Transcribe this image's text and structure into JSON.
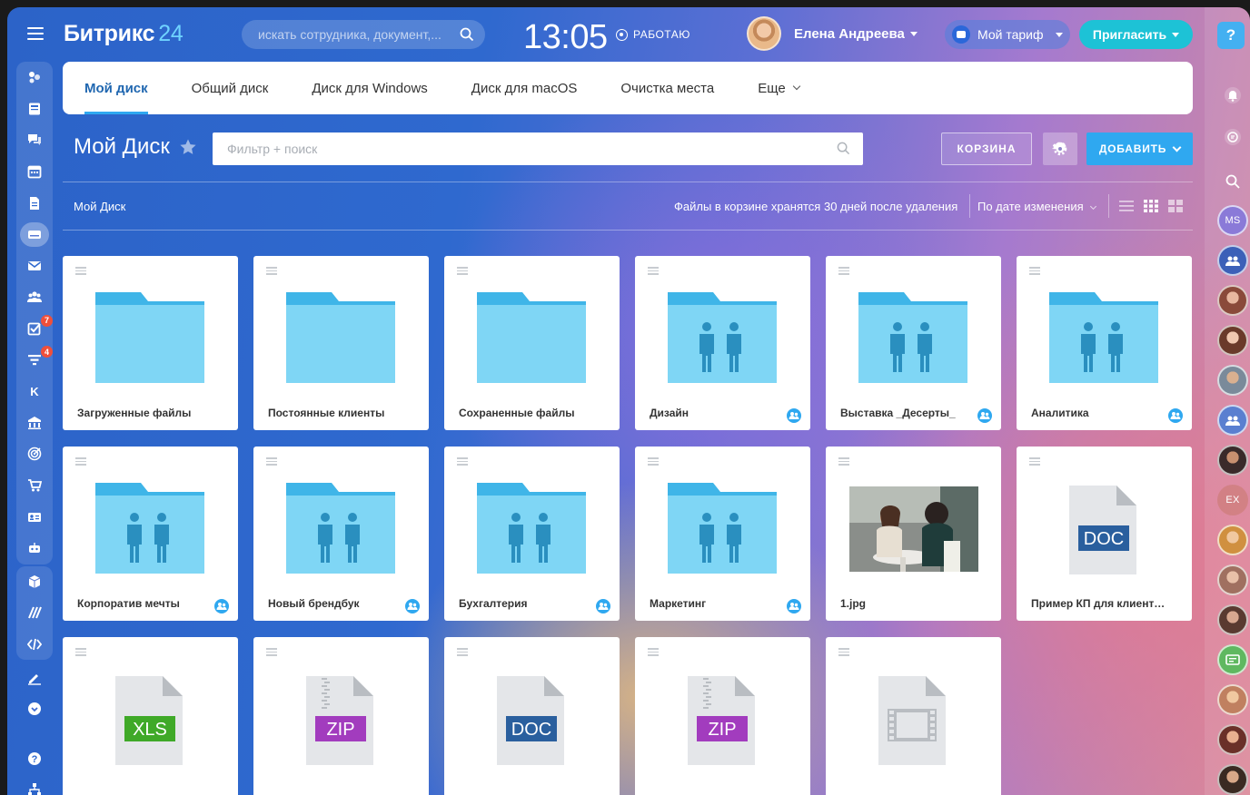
{
  "app": {
    "logo_text": "Битрикс",
    "logo_number": "24",
    "search_placeholder": "искать сотрудника, документ,...",
    "clock": "13:05",
    "status": "РАБОТАЮ",
    "user_name": "Елена Андреева",
    "tariff": "Мой тариф",
    "invite": "Пригласить",
    "help": "?"
  },
  "sidebar": {
    "badges": {
      "tasks": "7",
      "crm": "4"
    },
    "letter_item": "K"
  },
  "rightbar": {
    "initials_1": "MS",
    "initials_2": "EX"
  },
  "tabs": [
    {
      "label": "Мой диск",
      "active": true
    },
    {
      "label": "Общий диск"
    },
    {
      "label": "Диск для Windows"
    },
    {
      "label": "Диск для macOS"
    },
    {
      "label": "Очистка места"
    },
    {
      "label": "Еще"
    }
  ],
  "page": {
    "title": "Мой Диск",
    "filter_placeholder": "Фильтр + поиск",
    "trash_button": "КОРЗИНА",
    "add_button": "ДОБАВИТЬ",
    "breadcrumb": "Мой Диск",
    "trash_note": "Файлы в корзине хранятся 30 дней после удаления",
    "sort_label": "По дате изменения"
  },
  "items": [
    {
      "name": "Загруженные файлы",
      "type": "folder",
      "shared": false
    },
    {
      "name": "Постоянные клиенты",
      "type": "folder",
      "shared": false
    },
    {
      "name": "Сохраненные файлы",
      "type": "folder",
      "shared": false
    },
    {
      "name": "Дизайн",
      "type": "shared-folder",
      "shared": true
    },
    {
      "name": "Выставка _Десерты_",
      "type": "shared-folder",
      "shared": true
    },
    {
      "name": "Аналитика",
      "type": "shared-folder",
      "shared": true
    },
    {
      "name": "Корпоратив мечты",
      "type": "shared-folder",
      "shared": true
    },
    {
      "name": "Новый брендбук",
      "type": "shared-folder",
      "shared": true
    },
    {
      "name": "Бухгалтерия",
      "type": "shared-folder",
      "shared": true
    },
    {
      "name": "Маркетинг",
      "type": "shared-folder",
      "shared": true
    },
    {
      "name": "1.jpg",
      "type": "image",
      "shared": false
    },
    {
      "name": "Пример КП для клиентов....",
      "type": "doc",
      "label": "DOC",
      "shared": false
    },
    {
      "name": "",
      "type": "doc",
      "label": "XLS",
      "color": "#3fa928",
      "shared": false
    },
    {
      "name": "",
      "type": "zip",
      "label": "ZIP",
      "color": "#a23cbe",
      "shared": false
    },
    {
      "name": "",
      "type": "doc",
      "label": "DOC",
      "color": "#2a5f9e",
      "shared": false
    },
    {
      "name": "",
      "type": "zip",
      "label": "ZIP",
      "color": "#a23cbe",
      "shared": false
    },
    {
      "name": "",
      "type": "video",
      "shared": false
    }
  ],
  "colors": {
    "folder": "#7fd6f5",
    "folder_tab": "#3fb5e8",
    "people": "#2a8fbf",
    "accent": "#2fa8f0",
    "doc_blue": "#2a5f9e"
  }
}
